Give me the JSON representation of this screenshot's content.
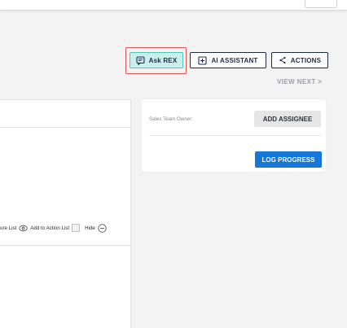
{
  "header": {
    "ask_rex_label": "Ask REX",
    "ai_assistant_label": "AI ASSISTANT",
    "actions_label": "ACTIONS",
    "view_next_label": "VIEW NEXT >"
  },
  "main": {
    "toolbar": {
      "partial_label": "ure List",
      "add_to_action_list_label": "Add to Action List",
      "hide_label": "Hide"
    }
  },
  "side_card": {
    "owner_label": "Sales Team Owner:",
    "add_assignee_label": "ADD ASSIGNEE",
    "log_progress_label": "LOG PROGRESS"
  },
  "colors": {
    "ask_rex_bg": "#c9f0ec",
    "primary_blue": "#1677d9",
    "highlight_red": "#e05252"
  }
}
